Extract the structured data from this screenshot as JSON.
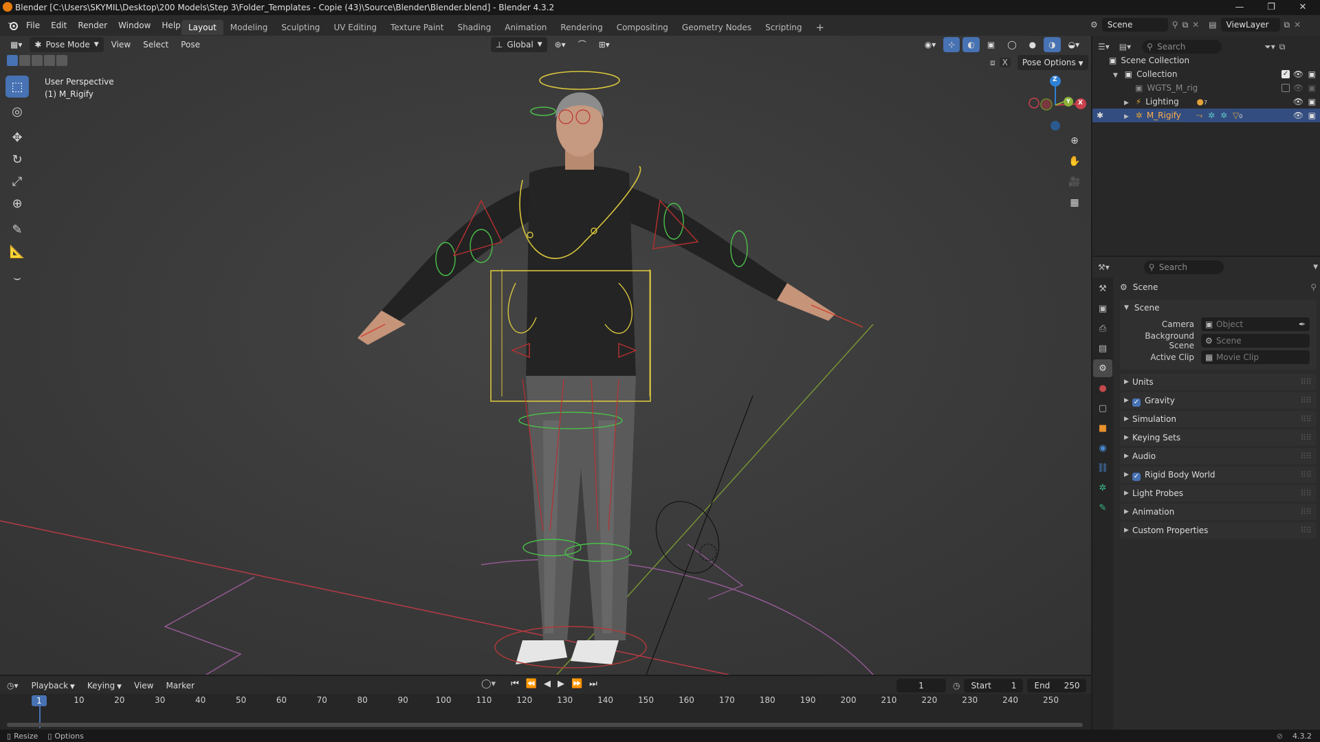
{
  "window": {
    "title": "Blender [C:\\Users\\SKYMIL\\Desktop\\200 Models\\Step 3\\Folder_Templates - Copie (43)\\Source\\Blender\\Blender.blend] - Blender 4.3.2",
    "minimize": "—",
    "maximize": "❐",
    "close": "✕"
  },
  "menu": [
    "File",
    "Edit",
    "Render",
    "Window",
    "Help"
  ],
  "workspaces": [
    "Layout",
    "Modeling",
    "Sculpting",
    "UV Editing",
    "Texture Paint",
    "Shading",
    "Animation",
    "Rendering",
    "Compositing",
    "Geometry Nodes",
    "Scripting"
  ],
  "workspace_add": "+",
  "scene_selector": {
    "value": "Scene"
  },
  "view_layer": {
    "value": "ViewLayer"
  },
  "viewport": {
    "mode": "Pose Mode",
    "menus": [
      "View",
      "Select",
      "Pose"
    ],
    "transform_orientation": "Global",
    "pose_options": "Pose Options",
    "overlay_text_1": "User Perspective",
    "overlay_text_2": "(1) M_Rigify",
    "gizmo_axes": {
      "z": "Z",
      "x": "X",
      "y": "Y"
    }
  },
  "outliner": {
    "search_placeholder": "Search",
    "rows": [
      {
        "label": "Scene Collection",
        "indent": 0
      },
      {
        "label": "Collection",
        "indent": 1
      },
      {
        "label": "WGTS_M_rig",
        "indent": 2
      },
      {
        "label": "Lighting",
        "indent": 2,
        "badge": "7"
      },
      {
        "label": "M_Rigify",
        "indent": 2,
        "badge": "0"
      }
    ]
  },
  "properties": {
    "search_placeholder": "Search",
    "context_title": "Scene",
    "panel_open": "Scene",
    "fields": [
      {
        "label": "Camera",
        "placeholder": "Object"
      },
      {
        "label": "Background Scene",
        "placeholder": "Scene"
      },
      {
        "label": "Active Clip",
        "placeholder": "Movie Clip"
      }
    ],
    "panels": [
      {
        "label": "Units",
        "checkbox": false
      },
      {
        "label": "Gravity",
        "checkbox": true
      },
      {
        "label": "Simulation",
        "checkbox": false
      },
      {
        "label": "Keying Sets",
        "checkbox": false
      },
      {
        "label": "Audio",
        "checkbox": false
      },
      {
        "label": "Rigid Body World",
        "checkbox": true
      },
      {
        "label": "Light Probes",
        "checkbox": false
      },
      {
        "label": "Animation",
        "checkbox": false
      },
      {
        "label": "Custom Properties",
        "checkbox": false
      }
    ]
  },
  "timeline": {
    "menus": [
      "Playback",
      "Keying",
      "View",
      "Marker"
    ],
    "current_frame": "1",
    "start_label": "Start",
    "start_value": "1",
    "end_label": "End",
    "end_value": "250",
    "ticks": [
      "10",
      "20",
      "30",
      "40",
      "50",
      "60",
      "70",
      "80",
      "90",
      "100",
      "110",
      "120",
      "130",
      "140",
      "150",
      "160",
      "170",
      "180",
      "190",
      "200",
      "210",
      "220",
      "230",
      "240",
      "250"
    ],
    "playhead": "1"
  },
  "statusbar": {
    "left_1": "Resize",
    "left_2": "Options",
    "version": "4.3.2"
  },
  "colors": {
    "accent": "#4772b3",
    "selection": "#334d80",
    "viewport_bg": "#3d3d3d",
    "x_axis": "#c8414c",
    "y_axis": "#8bb33a",
    "z_axis": "#2e80d4"
  }
}
